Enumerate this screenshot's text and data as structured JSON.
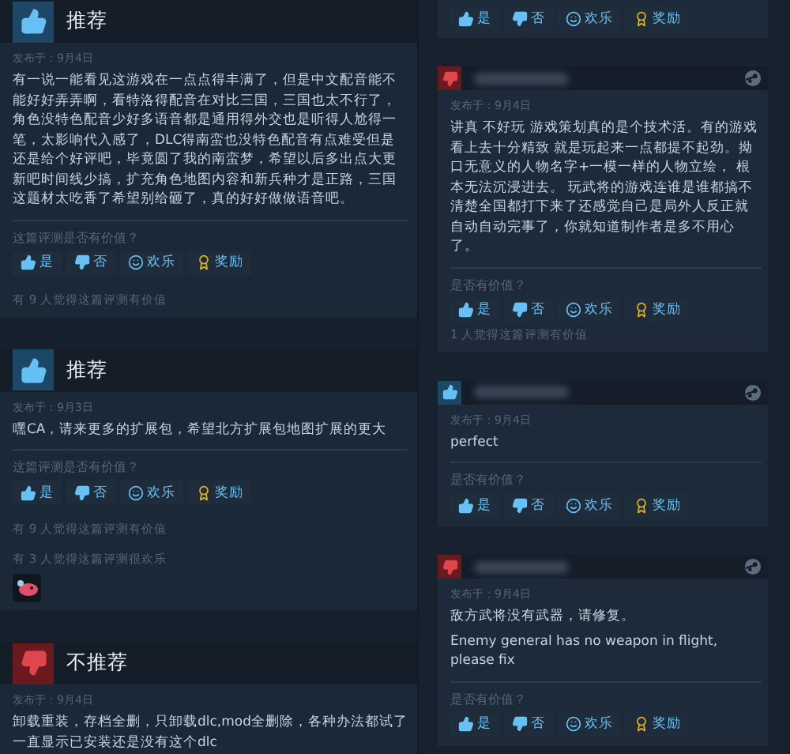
{
  "left_column": {
    "reviews": [
      {
        "recommended": true,
        "title": "推荐",
        "date": "发布于：9月4日",
        "body": [
          "有一说一能看见这游戏在一点点得丰满了，但是中文配音能不能好好弄弄啊，看特洛得配音在对比三国，三国也太不行了，角色没特色配音少好多语音都是通用得外交也是听得人尬得一笔，太影响代入感了，DLC得南蛮也没特色配音有点难受但是还是给个好评吧，毕竟圆了我的南蛮梦，希望以后多出点大更新吧时间线少搞，扩充角色地图内容和新兵种才是正路，三国这题材太吃香了希望别给砸了，真的好好做做语音吧。"
        ],
        "question": "这篇评测是否有价值？",
        "buttons": [
          {
            "kind": "yes",
            "label": "是"
          },
          {
            "kind": "no",
            "label": "否"
          },
          {
            "kind": "funny",
            "label": "欢乐"
          },
          {
            "kind": "award",
            "label": "奖励"
          }
        ],
        "counts": [
          "有 9 人觉得这篇评测有价值"
        ]
      },
      {
        "recommended": true,
        "title": "推荐",
        "date": "发布于：9月3日",
        "body": [
          "嘿CA，请来更多的扩展包，希望北方扩展包地图扩展的更大"
        ],
        "question": "这篇评测是否有价值？",
        "buttons": [
          {
            "kind": "yes",
            "label": "是"
          },
          {
            "kind": "no",
            "label": "否"
          },
          {
            "kind": "funny",
            "label": "欢乐"
          },
          {
            "kind": "award",
            "label": "奖励"
          }
        ],
        "counts": [
          "有 9 人觉得这篇评测有价值",
          "有 3 人觉得这篇评测很欢乐"
        ],
        "award_sticker": true
      },
      {
        "recommended": false,
        "title": "不推荐",
        "date": "发布于：9月4日",
        "body": [
          "卸载重装，存档全删，只卸载dlc,mod全删除，各种办法都试了一直显示已安装还是没有这个dlc"
        ]
      }
    ]
  },
  "right_column": {
    "top_buttons": [
      {
        "kind": "yes",
        "label": "是"
      },
      {
        "kind": "no",
        "label": "否"
      },
      {
        "kind": "funny",
        "label": "欢乐"
      },
      {
        "kind": "award",
        "label": "奖励"
      }
    ],
    "reviews": [
      {
        "recommended": false,
        "date": "发布于：9月4日",
        "body": [
          "讲真 不好玩 游戏策划真的是个技术活。有的游戏看上去十分精致 就是玩起来一点都提不起劲。拗口无意义的人物名字+一模一样的人物立绘， 根本无法沉浸进去。 玩武将的游戏连谁是谁都搞不清楚全国都打下来了还感觉自己是局外人反正就自动自动完事了，你就知道制作者是多不用心了。"
        ],
        "question": "是否有价值？",
        "buttons": [
          {
            "kind": "yes",
            "label": "是"
          },
          {
            "kind": "no",
            "label": "否"
          },
          {
            "kind": "funny",
            "label": "欢乐"
          },
          {
            "kind": "award",
            "label": "奖励"
          }
        ],
        "counts": [
          "1 人觉得这篇评测有价值"
        ]
      },
      {
        "recommended": true,
        "date": "发布于：9月4日",
        "body": [
          "perfect"
        ],
        "question": "是否有价值？",
        "buttons": [
          {
            "kind": "yes",
            "label": "是"
          },
          {
            "kind": "no",
            "label": "否"
          },
          {
            "kind": "funny",
            "label": "欢乐"
          },
          {
            "kind": "award",
            "label": "奖励"
          }
        ]
      },
      {
        "recommended": false,
        "date": "发布于：9月4日",
        "body": [
          "敌方武将没有武器，请修复。",
          "Enemy general has no weapon in flight, please fix"
        ],
        "question": "是否有价值？",
        "buttons": [
          {
            "kind": "yes",
            "label": "是"
          },
          {
            "kind": "no",
            "label": "否"
          },
          {
            "kind": "funny",
            "label": "欢乐"
          },
          {
            "kind": "award",
            "label": "奖励"
          }
        ]
      }
    ]
  }
}
